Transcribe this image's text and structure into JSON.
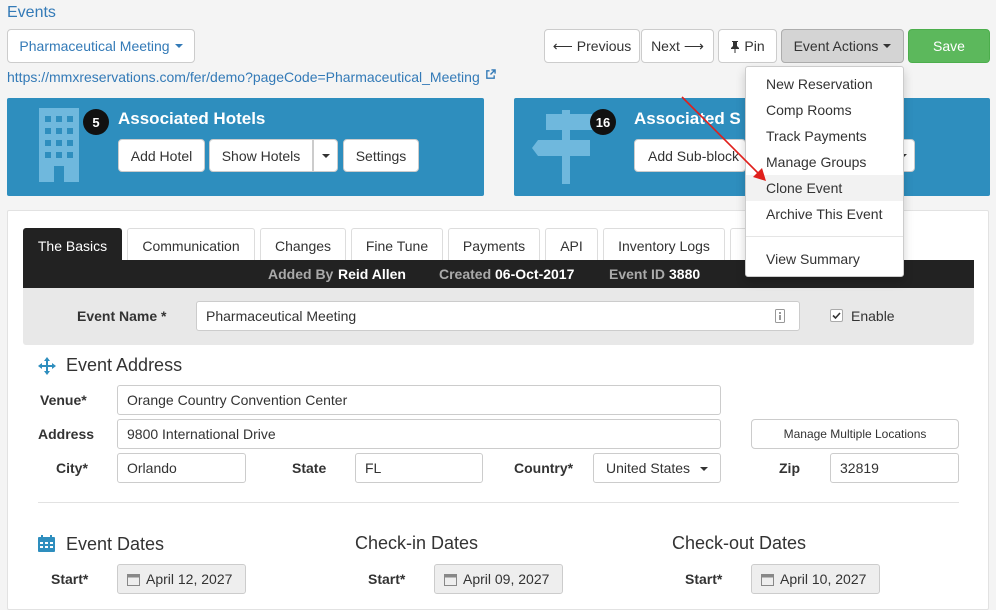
{
  "breadcrumb": "Events",
  "event_selector": "Pharmaceutical Meeting",
  "event_url": "https://mmxreservations.com/fer/demo?pageCode=Pharmaceutical_Meeting",
  "toolbar": {
    "previous": "Previous",
    "next": "Next",
    "pin": "Pin",
    "event_actions": "Event Actions",
    "save": "Save"
  },
  "menu": {
    "items": [
      "New Reservation",
      "Comp Rooms",
      "Track Payments",
      "Manage Groups",
      "Clone Event",
      "Archive This Event"
    ],
    "summary": "View Summary"
  },
  "hotels_panel": {
    "count": "5",
    "title": "Associated Hotels",
    "add": "Add Hotel",
    "show": "Show Hotels",
    "settings": "Settings"
  },
  "subblocks_panel": {
    "count": "16",
    "title": "Associated S",
    "add": "Add Sub-block"
  },
  "tabs": [
    "The Basics",
    "Communication",
    "Changes",
    "Fine Tune",
    "Payments",
    "API",
    "Inventory Logs"
  ],
  "info_bar": {
    "added_by_label": "Added By",
    "added_by_value": "Reid Allen",
    "created_label": "Created",
    "created_value": "06-Oct-2017",
    "event_id_label": "Event ID",
    "event_id_value": "3880"
  },
  "event_name": {
    "label": "Event Name *",
    "value": "Pharmaceutical Meeting",
    "enable_label": "Enable",
    "enabled": true
  },
  "address": {
    "section_title": "Event Address",
    "venue_label": "Venue*",
    "venue_value": "Orange Country Convention Center",
    "address_label": "Address",
    "address_value": "9800 International Drive",
    "manage_locations": "Manage Multiple Locations",
    "city_label": "City*",
    "city_value": "Orlando",
    "state_label": "State",
    "state_value": "FL",
    "country_label": "Country*",
    "country_value": "United States",
    "zip_label": "Zip",
    "zip_value": "32819"
  },
  "dates": {
    "event_title": "Event Dates",
    "checkin_title": "Check-in Dates",
    "checkout_title": "Check-out Dates",
    "start_label": "Start*",
    "event_start": "April 12, 2027",
    "checkin_start": "April 09, 2027",
    "checkout_start": "April 10, 2027"
  },
  "colors": {
    "accent_blue": "#337ab7",
    "panel_blue": "#2e8ebe",
    "save_green": "#5cb85c",
    "arrow_red": "#e0201c"
  }
}
